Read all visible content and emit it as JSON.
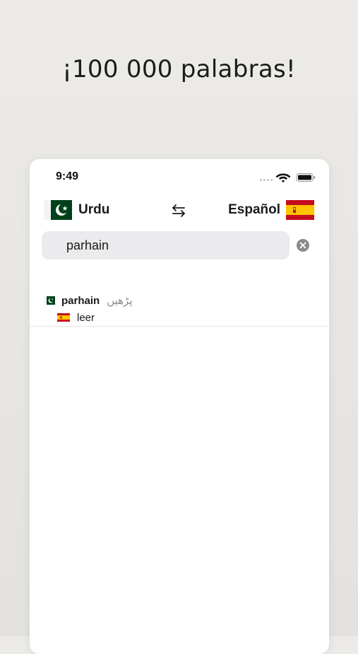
{
  "headline": "¡100 000 palabras!",
  "status_bar": {
    "time": "9:49"
  },
  "languages": {
    "source": {
      "label": "Urdu",
      "flag": "pakistan-flag"
    },
    "target": {
      "label": "Español",
      "flag": "spain-flag"
    },
    "swap_icon": "swap-arrows-icon"
  },
  "search": {
    "value": "parhain",
    "clear_icon": "clear-icon"
  },
  "results": [
    {
      "word": "parhain",
      "native": "پڑھیں",
      "translation": "leer"
    }
  ],
  "colors": {
    "pakistan_green": "#01411c",
    "spain_red": "#c60b1e",
    "spain_yellow": "#ffc400",
    "background": "#e9e7e4"
  }
}
